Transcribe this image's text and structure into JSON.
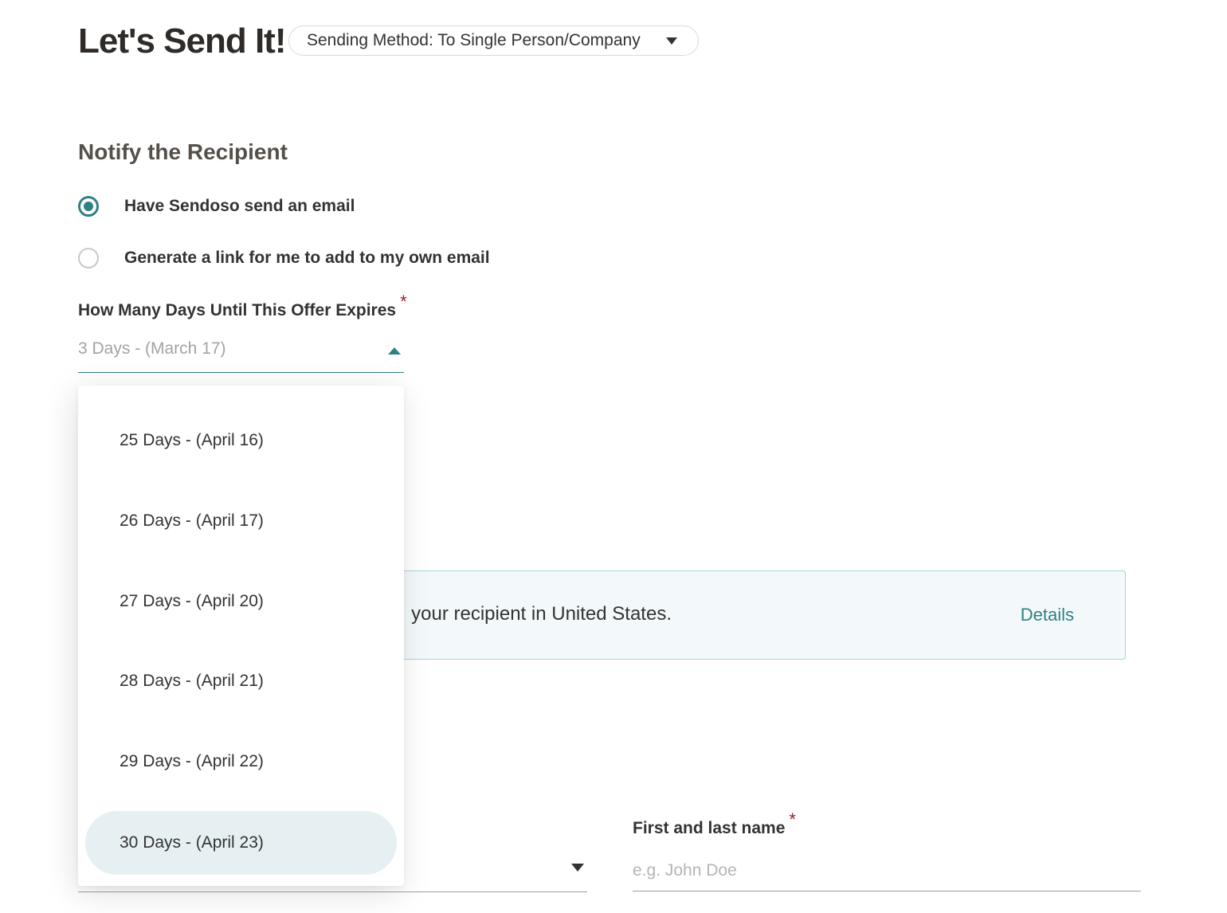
{
  "header": {
    "title": "Let's Send It!",
    "sending_method": "Sending Method: To Single Person/Company"
  },
  "notify": {
    "title": "Notify the Recipient",
    "options": [
      {
        "label": "Have Sendoso send an email",
        "selected": true
      },
      {
        "label": "Generate a link for me to add to my own email",
        "selected": false
      }
    ]
  },
  "expiry": {
    "label": "How Many Days Until This Offer Expires",
    "required_mark": "*",
    "value": "3 Days - (March 17)",
    "options": [
      {
        "label": "25 Days - (April 16)",
        "selected": false
      },
      {
        "label": "26 Days - (April 17)",
        "selected": false
      },
      {
        "label": "27 Days - (April 20)",
        "selected": false
      },
      {
        "label": "28 Days - (April 21)",
        "selected": false
      },
      {
        "label": "29 Days - (April 22)",
        "selected": false
      },
      {
        "label": "30 Days - (April 23)",
        "selected": true
      }
    ]
  },
  "notice": {
    "text": "your recipient in United States.",
    "link": "Details"
  },
  "recipient": {
    "name_label": "First and last name",
    "required_mark": "*",
    "name_placeholder": "e.g. John Doe"
  },
  "colors": {
    "accent": "#2f7f86",
    "required": "#9b1c2a",
    "selected_option_bg": "#e6f0f2",
    "notice_bg": "#f3f9fa"
  },
  "icons": {
    "method_caret": "chevron-down-icon",
    "expiry_caret": "chevron-up-icon",
    "country_caret": "chevron-down-icon"
  }
}
